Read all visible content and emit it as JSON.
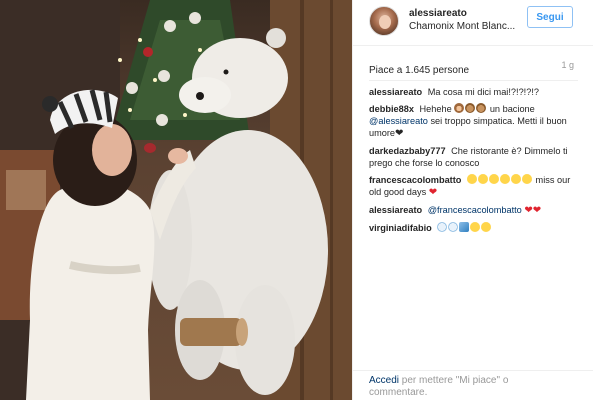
{
  "post": {
    "username": "alessiareato",
    "location": "Chamonix Mont Blanc...",
    "follow_label": "Segui",
    "likes": "Piace a 1.645 persone",
    "time": "1 g"
  },
  "comments": [
    {
      "user": "alessiareato",
      "text": "Ma cosa mi dici mai!?!?!?!?"
    },
    {
      "user": "debbie88x",
      "text": "Hehehe",
      "emojis": [
        "monkey-emoji",
        "bear-emoji",
        "bear-emoji"
      ],
      "text2": "un bacione",
      "mention": "@alessiareato",
      "text3": "sei troppo simpatica. Metti il buon umore",
      "heart": "❤"
    },
    {
      "user": "darkedazbaby777",
      "text": "Che ristorante è? Dimmelo ti prego che forse lo conosco"
    },
    {
      "user": "francescacolombatto",
      "emojis": [
        "grin-emoji",
        "grin-emoji",
        "grin-emoji",
        "grin-emoji",
        "grin-emoji",
        "grin-emoji"
      ],
      "text": "miss our old good days",
      "heart": "❤"
    },
    {
      "user": "alessiareato",
      "mention": "@francescacolombatto",
      "heart": "❤❤"
    },
    {
      "user": "virginiadifabio",
      "emojis": [
        "snowflake-emoji",
        "snowflake-emoji",
        "skier-emoji",
        "smile-emoji",
        "smile-emoji"
      ]
    }
  ],
  "footer": {
    "login_label": "Accedi",
    "prompt": "per mettere \"Mi piace\" o commentare."
  },
  "colors": {
    "link_blue": "#3897f0",
    "mention_blue": "#003569",
    "heart_red": "#e0242f",
    "border": "#efefef"
  }
}
